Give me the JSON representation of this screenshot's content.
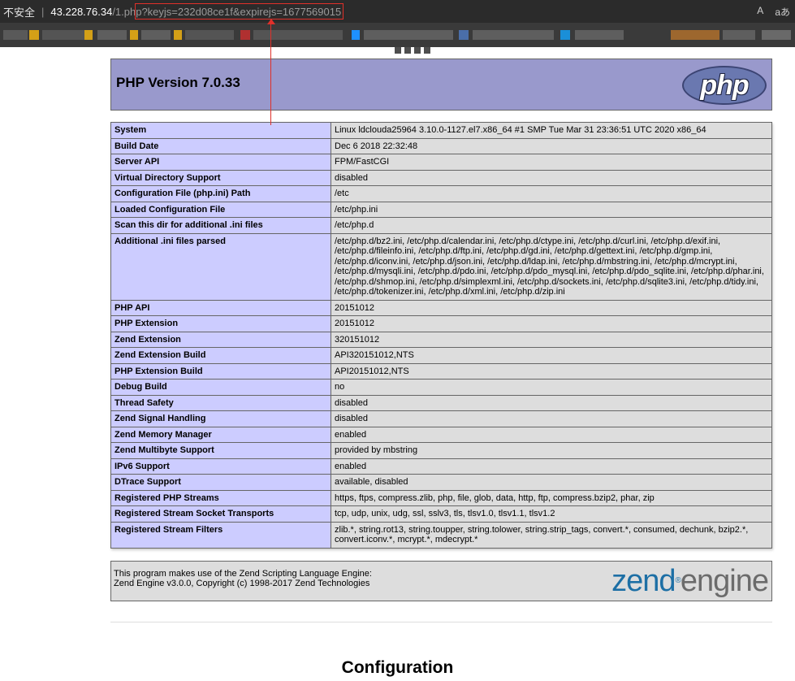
{
  "browser": {
    "insecure_label": "不安全",
    "url_host": "43.228.76.34",
    "url_path": "/1.php?keyjs=232d08ce1f&expirejs=1677569015",
    "read_aloud_label": "A",
    "font_toggle_label": "aあ"
  },
  "header": {
    "title": "PHP Version 7.0.33",
    "logo_text": "php"
  },
  "info_rows": [
    {
      "key": "System",
      "value": "Linux ldclouda25964 3.10.0-1127.el7.x86_64 #1 SMP Tue Mar 31 23:36:51 UTC 2020 x86_64"
    },
    {
      "key": "Build Date",
      "value": "Dec 6 2018 22:32:48"
    },
    {
      "key": "Server API",
      "value": "FPM/FastCGI"
    },
    {
      "key": "Virtual Directory Support",
      "value": "disabled"
    },
    {
      "key": "Configuration File (php.ini) Path",
      "value": "/etc"
    },
    {
      "key": "Loaded Configuration File",
      "value": "/etc/php.ini"
    },
    {
      "key": "Scan this dir for additional .ini files",
      "value": "/etc/php.d"
    },
    {
      "key": "Additional .ini files parsed",
      "value": "/etc/php.d/bz2.ini, /etc/php.d/calendar.ini, /etc/php.d/ctype.ini, /etc/php.d/curl.ini, /etc/php.d/exif.ini, /etc/php.d/fileinfo.ini, /etc/php.d/ftp.ini, /etc/php.d/gd.ini, /etc/php.d/gettext.ini, /etc/php.d/gmp.ini, /etc/php.d/iconv.ini, /etc/php.d/json.ini, /etc/php.d/ldap.ini, /etc/php.d/mbstring.ini, /etc/php.d/mcrypt.ini, /etc/php.d/mysqli.ini, /etc/php.d/pdo.ini, /etc/php.d/pdo_mysql.ini, /etc/php.d/pdo_sqlite.ini, /etc/php.d/phar.ini, /etc/php.d/shmop.ini, /etc/php.d/simplexml.ini, /etc/php.d/sockets.ini, /etc/php.d/sqlite3.ini, /etc/php.d/tidy.ini, /etc/php.d/tokenizer.ini, /etc/php.d/xml.ini, /etc/php.d/zip.ini"
    },
    {
      "key": "PHP API",
      "value": "20151012"
    },
    {
      "key": "PHP Extension",
      "value": "20151012"
    },
    {
      "key": "Zend Extension",
      "value": "320151012"
    },
    {
      "key": "Zend Extension Build",
      "value": "API320151012,NTS"
    },
    {
      "key": "PHP Extension Build",
      "value": "API20151012,NTS"
    },
    {
      "key": "Debug Build",
      "value": "no"
    },
    {
      "key": "Thread Safety",
      "value": "disabled"
    },
    {
      "key": "Zend Signal Handling",
      "value": "disabled"
    },
    {
      "key": "Zend Memory Manager",
      "value": "enabled"
    },
    {
      "key": "Zend Multibyte Support",
      "value": "provided by mbstring"
    },
    {
      "key": "IPv6 Support",
      "value": "enabled"
    },
    {
      "key": "DTrace Support",
      "value": "available, disabled"
    },
    {
      "key": "Registered PHP Streams",
      "value": "https, ftps, compress.zlib, php, file, glob, data, http, ftp, compress.bzip2, phar, zip"
    },
    {
      "key": "Registered Stream Socket Transports",
      "value": "tcp, udp, unix, udg, ssl, sslv3, tls, tlsv1.0, tlsv1.1, tlsv1.2"
    },
    {
      "key": "Registered Stream Filters",
      "value": "zlib.*, string.rot13, string.toupper, string.tolower, string.strip_tags, convert.*, consumed, dechunk, bzip2.*, convert.iconv.*, mcrypt.*, mdecrypt.*"
    }
  ],
  "zend": {
    "line1": "This program makes use of the Zend Scripting Language Engine:",
    "line2": "Zend Engine v3.0.0, Copyright (c) 1998-2017 Zend Technologies",
    "logo_word1": "zend",
    "logo_word2": "engine"
  },
  "section_title": "Configuration",
  "colors": {
    "header_bg": "#9999cc",
    "key_bg": "#ccccff",
    "value_bg": "#dddddd",
    "annotation": "#e0302a"
  }
}
